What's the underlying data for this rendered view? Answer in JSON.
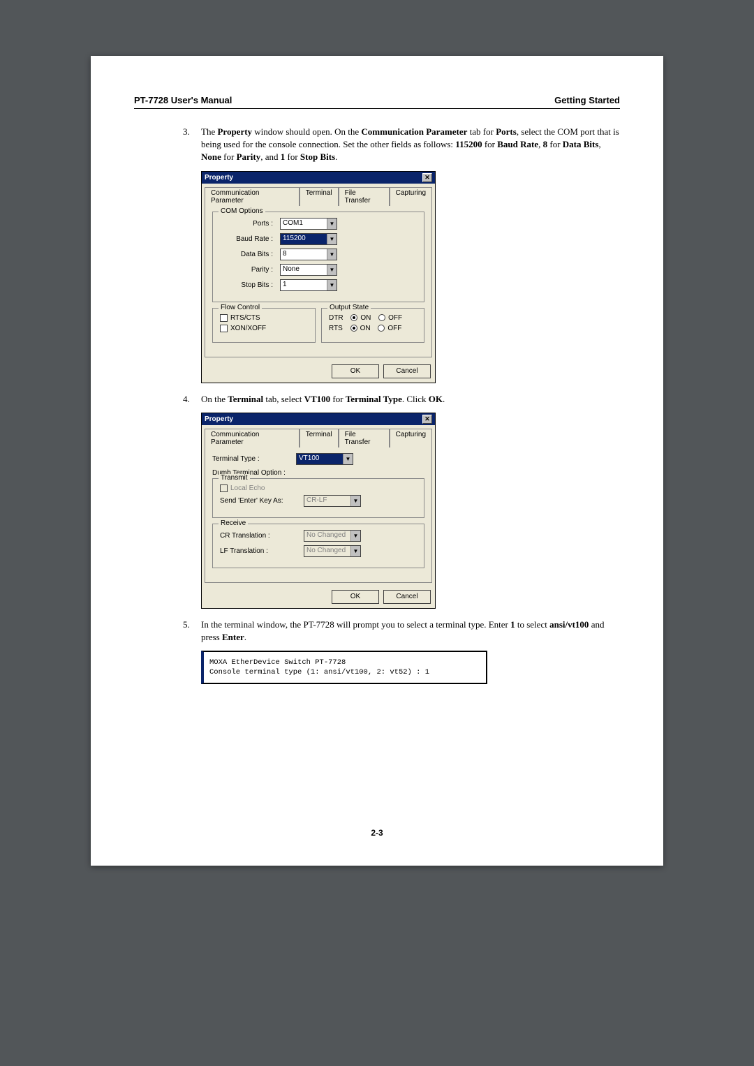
{
  "header": {
    "left": "PT-7728 User's Manual",
    "right": "Getting Started"
  },
  "steps": [
    {
      "num": "3.",
      "segments": [
        {
          "t": "The "
        },
        {
          "t": "Property",
          "b": true
        },
        {
          "t": " window should open. On the "
        },
        {
          "t": "Communication Parameter",
          "b": true
        },
        {
          "t": " tab for "
        },
        {
          "t": "Ports",
          "b": true
        },
        {
          "t": ", select the COM port that is being used for the console connection. Set the other fields as follows: "
        },
        {
          "t": "115200",
          "b": true
        },
        {
          "t": " for "
        },
        {
          "t": "Baud Rate",
          "b": true
        },
        {
          "t": ", "
        },
        {
          "t": "8",
          "b": true
        },
        {
          "t": " for "
        },
        {
          "t": "Data Bits",
          "b": true
        },
        {
          "t": ", "
        },
        {
          "t": "None",
          "b": true
        },
        {
          "t": " for "
        },
        {
          "t": "Parity",
          "b": true
        },
        {
          "t": ", and "
        },
        {
          "t": "1",
          "b": true
        },
        {
          "t": " for "
        },
        {
          "t": "Stop Bits",
          "b": true
        },
        {
          "t": "."
        }
      ]
    },
    {
      "num": "4.",
      "segments": [
        {
          "t": "On the "
        },
        {
          "t": "Terminal",
          "b": true
        },
        {
          "t": " tab, select "
        },
        {
          "t": "VT100",
          "b": true
        },
        {
          "t": " for "
        },
        {
          "t": "Terminal Type",
          "b": true
        },
        {
          "t": ". Click "
        },
        {
          "t": "OK",
          "b": true
        },
        {
          "t": "."
        }
      ]
    },
    {
      "num": "5.",
      "segments": [
        {
          "t": "In the terminal window, the PT-7728 will prompt you to select a terminal type. Enter "
        },
        {
          "t": "1",
          "b": true
        },
        {
          "t": " to select "
        },
        {
          "t": "ansi/vt100",
          "b": true
        },
        {
          "t": " and press "
        },
        {
          "t": "Enter",
          "b": true
        },
        {
          "t": "."
        }
      ]
    }
  ],
  "dialog1": {
    "title": "Property",
    "tabs": [
      "Communication Parameter",
      "Terminal",
      "File Transfer",
      "Capturing"
    ],
    "activeTab": 0,
    "comGroup": {
      "legend": "COM Options",
      "rows": [
        {
          "label": "Ports :",
          "value": "COM1",
          "selected": false
        },
        {
          "label": "Baud Rate :",
          "value": "115200",
          "selected": true
        },
        {
          "label": "Data Bits :",
          "value": "8",
          "selected": false
        },
        {
          "label": "Parity :",
          "value": "None",
          "selected": false
        },
        {
          "label": "Stop Bits :",
          "value": "1",
          "selected": false
        }
      ]
    },
    "flowGroup": {
      "legend": "Flow Control",
      "items": [
        "RTS/CTS",
        "XON/XOFF"
      ]
    },
    "outGroup": {
      "legend": "Output State",
      "rows": [
        {
          "label": "DTR",
          "on": "ON",
          "off": "OFF",
          "sel": "on"
        },
        {
          "label": "RTS",
          "on": "ON",
          "off": "OFF",
          "sel": "on"
        }
      ]
    },
    "buttons": {
      "ok": "OK",
      "cancel": "Cancel"
    }
  },
  "dialog2": {
    "title": "Property",
    "tabs": [
      "Communication Parameter",
      "Terminal",
      "File Transfer",
      "Capturing"
    ],
    "activeTab": 1,
    "termType": {
      "label": "Terminal Type :",
      "value": "VT100",
      "selected": true
    },
    "dumbLabel": "Dumb Terminal Option :",
    "transmit": {
      "legend": "Transmit",
      "localEcho": "Local Echo",
      "sendKey": {
        "label": "Send 'Enter' Key As:",
        "value": "CR-LF"
      }
    },
    "receive": {
      "legend": "Receive",
      "rows": [
        {
          "label": "CR Translation :",
          "value": "No Changed"
        },
        {
          "label": "LF Translation :",
          "value": "No Changed"
        }
      ]
    },
    "buttons": {
      "ok": "OK",
      "cancel": "Cancel"
    }
  },
  "terminal": {
    "line1": "MOXA EtherDevice Switch  PT-7728",
    "line2": "Console terminal type (1: ansi/vt100, 2: vt52) : 1"
  },
  "pageNumber": "2-3"
}
